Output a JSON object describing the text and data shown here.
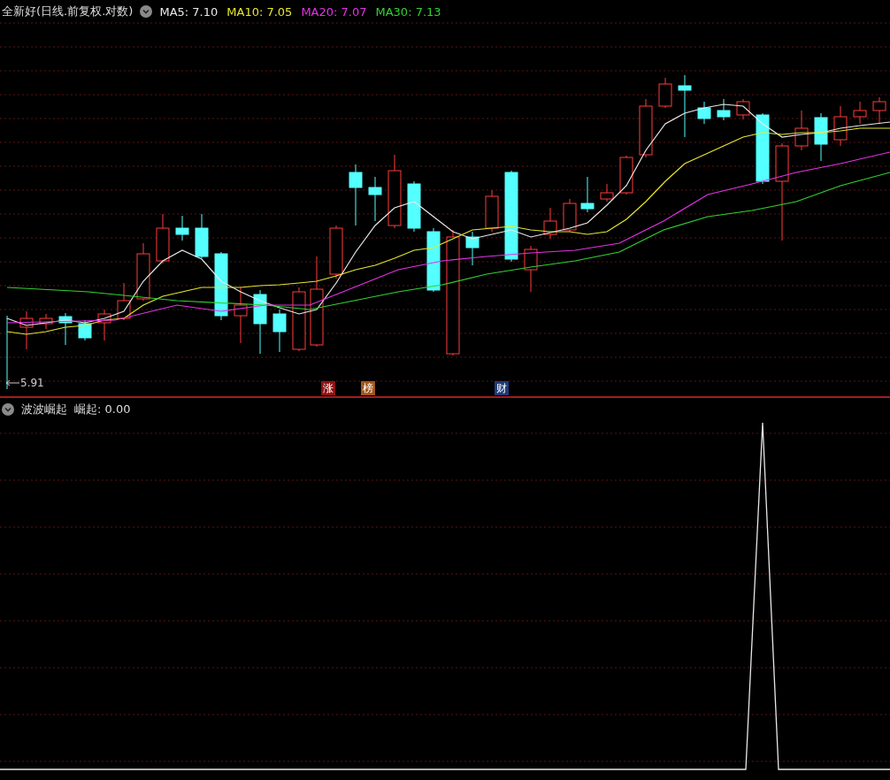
{
  "main_panel": {
    "title": "全新好(日线.前复权.对数)",
    "moving_averages": [
      {
        "label": "MA5: 7.10",
        "color": "#e8e8e8"
      },
      {
        "label": "MA10: 7.05",
        "color": "#e6e62e"
      },
      {
        "label": "MA20: 7.07",
        "color": "#e632e6"
      },
      {
        "label": "MA30: 7.13",
        "color": "#32d232"
      }
    ],
    "low_price": "5.91",
    "event_tags": [
      {
        "label": "涨",
        "color": "#8c1414"
      },
      {
        "label": "榜",
        "color": "#a0561c"
      },
      {
        "label": "财",
        "color": "#1e3c78"
      }
    ]
  },
  "indicator_panel": {
    "title": "波波崛起",
    "value": "崛起: 0.00"
  }
}
